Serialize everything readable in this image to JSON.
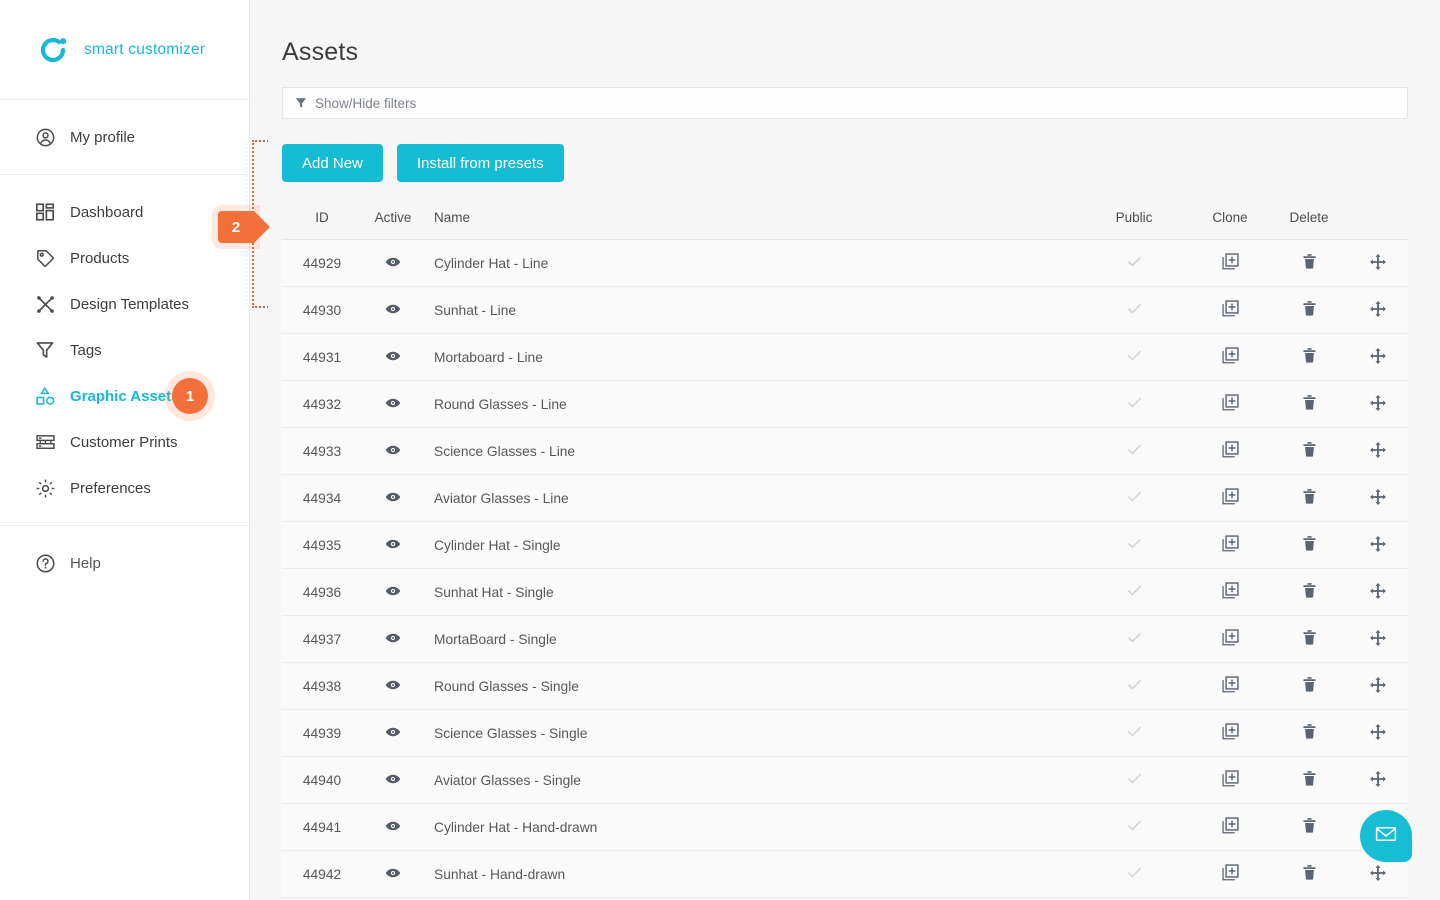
{
  "brand": {
    "name": "smart customizer",
    "logo_icon": "circle-dot-logo-icon",
    "accent_color": "#19b9d4"
  },
  "sidebar": {
    "groups": [
      {
        "items": [
          {
            "label": "My profile",
            "icon": "user-circle-icon",
            "active": false
          }
        ]
      },
      {
        "items": [
          {
            "label": "Dashboard",
            "icon": "grid-dashboard-icon",
            "active": false,
            "badge": "2"
          },
          {
            "label": "Products",
            "icon": "tag-icon",
            "active": false
          },
          {
            "label": "Design Templates",
            "icon": "design-templates-icon",
            "active": false
          },
          {
            "label": "Tags",
            "icon": "funnel-tags-icon",
            "active": false
          },
          {
            "label": "Graphic Assets",
            "icon": "shapes-icon",
            "active": true,
            "badge": "1"
          },
          {
            "label": "Customer Prints",
            "icon": "customer-prints-icon",
            "active": false
          },
          {
            "label": "Preferences",
            "icon": "gear-icon",
            "active": false
          }
        ]
      },
      {
        "items": [
          {
            "label": "Help",
            "icon": "question-circle-icon",
            "active": false
          }
        ]
      }
    ],
    "annotations": {
      "badge_one": "1",
      "badge_two": "2",
      "badge_color": "#f4703a"
    }
  },
  "main": {
    "title": "Assets",
    "filter": {
      "label": "Show/Hide filters",
      "icon": "funnel-filter-icon"
    },
    "buttons": {
      "add_new": "Add New",
      "install_presets": "Install from presets"
    }
  },
  "table": {
    "headers": {
      "id": "ID",
      "active": "Active",
      "name": "Name",
      "public": "Public",
      "clone": "Clone",
      "delete": "Delete"
    },
    "icons": {
      "active": "eye-icon",
      "public": "check-icon",
      "clone": "copy-plus-icon",
      "delete": "trash-icon",
      "move": "move-arrows-icon"
    },
    "rows": [
      {
        "id": "44929",
        "name": "Cylinder Hat - Line"
      },
      {
        "id": "44930",
        "name": "Sunhat - Line"
      },
      {
        "id": "44931",
        "name": "Mortaboard - Line"
      },
      {
        "id": "44932",
        "name": "Round Glasses - Line"
      },
      {
        "id": "44933",
        "name": "Science Glasses - Line"
      },
      {
        "id": "44934",
        "name": "Aviator Glasses - Line"
      },
      {
        "id": "44935",
        "name": "Cylinder Hat - Single"
      },
      {
        "id": "44936",
        "name": "Sunhat Hat - Single"
      },
      {
        "id": "44937",
        "name": "MortaBoard - Single"
      },
      {
        "id": "44938",
        "name": "Round Glasses - Single"
      },
      {
        "id": "44939",
        "name": "Science Glasses - Single"
      },
      {
        "id": "44940",
        "name": "Aviator Glasses - Single"
      },
      {
        "id": "44941",
        "name": "Cylinder Hat - Hand-drawn"
      },
      {
        "id": "44942",
        "name": "Sunhat - Hand-drawn"
      }
    ]
  },
  "chat": {
    "icon": "envelope-icon",
    "color": "#16bdd3"
  }
}
